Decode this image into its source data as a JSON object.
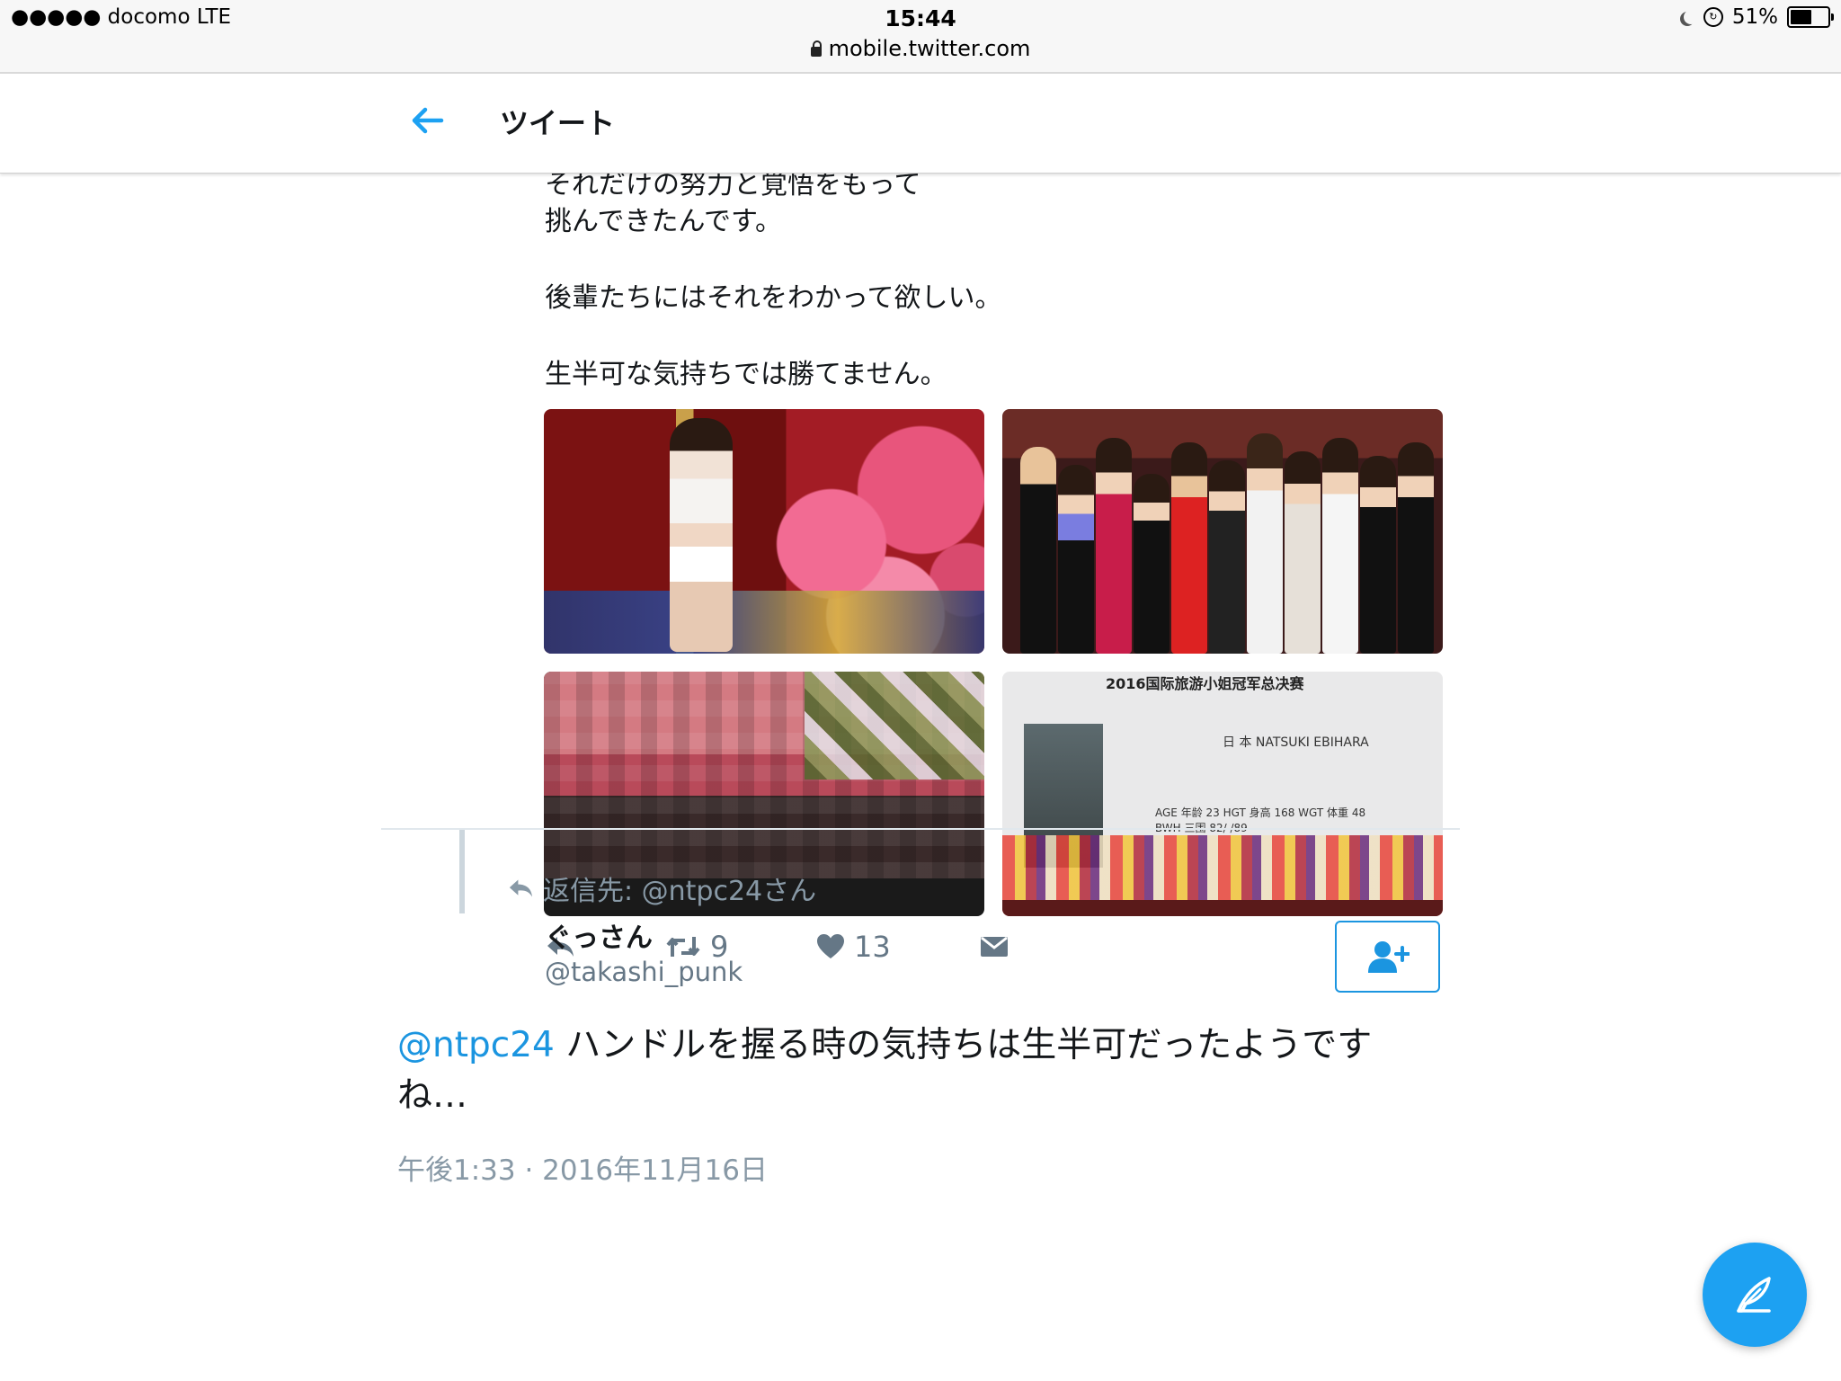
{
  "status_bar": {
    "carrier": "●●●●● docomo  LTE",
    "time": "15:44",
    "battery": "51%",
    "battery_level": 0.51,
    "url": "mobile.twitter.com"
  },
  "header": {
    "title": "ツイート",
    "back_icon": "arrow-left-icon"
  },
  "tweet": {
    "lines": [
      "それだけの努力と覚悟をもって",
      "挑んできたんです。",
      "後輩たちにはそれをわかって欲しい。",
      "生半可な気持ちでは勝てません。"
    ],
    "media_text": {
      "stage_title": "2016国际旅游小姐冠军总决赛",
      "stage_name": "日 本   NATSUKI EBIHARA",
      "stage_stats_1": "AGE  年龄  23   HGT   身高  168   WGT   体重  48",
      "stage_stats_2": "BWH  三围  82/  /89"
    },
    "actions": {
      "reply_icon": "reply-icon",
      "retweet_icon": "retweet-icon",
      "retweet_count": "9",
      "like_icon": "heart-icon",
      "like_count": "13",
      "dm_icon": "envelope-icon"
    }
  },
  "reply": {
    "context": "返信先: @ntpc24さん",
    "display_name": "ぐっさん",
    "handle": "@takashi_punk",
    "follow_icon": "add-user-icon",
    "mention": "@ntpc24",
    "text_line1": " ハンドルを握る時の気持ちは生半可だったようです",
    "text_line2": "ね…",
    "timestamp": "午後1:33 · 2016年11月16日"
  },
  "compose": {
    "icon": "compose-feather-icon"
  },
  "colors": {
    "accent": "#1da1f2",
    "link": "#1b95e0",
    "muted": "#8899a6"
  }
}
